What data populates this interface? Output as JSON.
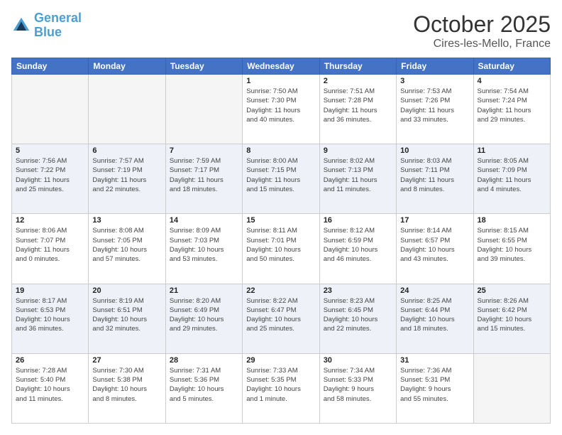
{
  "logo": {
    "line1": "General",
    "line2": "Blue"
  },
  "title": "October 2025",
  "location": "Cires-les-Mello, France",
  "weekdays": [
    "Sunday",
    "Monday",
    "Tuesday",
    "Wednesday",
    "Thursday",
    "Friday",
    "Saturday"
  ],
  "weeks": [
    [
      {
        "day": "",
        "info": ""
      },
      {
        "day": "",
        "info": ""
      },
      {
        "day": "",
        "info": ""
      },
      {
        "day": "1",
        "info": "Sunrise: 7:50 AM\nSunset: 7:30 PM\nDaylight: 11 hours\nand 40 minutes."
      },
      {
        "day": "2",
        "info": "Sunrise: 7:51 AM\nSunset: 7:28 PM\nDaylight: 11 hours\nand 36 minutes."
      },
      {
        "day": "3",
        "info": "Sunrise: 7:53 AM\nSunset: 7:26 PM\nDaylight: 11 hours\nand 33 minutes."
      },
      {
        "day": "4",
        "info": "Sunrise: 7:54 AM\nSunset: 7:24 PM\nDaylight: 11 hours\nand 29 minutes."
      }
    ],
    [
      {
        "day": "5",
        "info": "Sunrise: 7:56 AM\nSunset: 7:22 PM\nDaylight: 11 hours\nand 25 minutes."
      },
      {
        "day": "6",
        "info": "Sunrise: 7:57 AM\nSunset: 7:19 PM\nDaylight: 11 hours\nand 22 minutes."
      },
      {
        "day": "7",
        "info": "Sunrise: 7:59 AM\nSunset: 7:17 PM\nDaylight: 11 hours\nand 18 minutes."
      },
      {
        "day": "8",
        "info": "Sunrise: 8:00 AM\nSunset: 7:15 PM\nDaylight: 11 hours\nand 15 minutes."
      },
      {
        "day": "9",
        "info": "Sunrise: 8:02 AM\nSunset: 7:13 PM\nDaylight: 11 hours\nand 11 minutes."
      },
      {
        "day": "10",
        "info": "Sunrise: 8:03 AM\nSunset: 7:11 PM\nDaylight: 11 hours\nand 8 minutes."
      },
      {
        "day": "11",
        "info": "Sunrise: 8:05 AM\nSunset: 7:09 PM\nDaylight: 11 hours\nand 4 minutes."
      }
    ],
    [
      {
        "day": "12",
        "info": "Sunrise: 8:06 AM\nSunset: 7:07 PM\nDaylight: 11 hours\nand 0 minutes."
      },
      {
        "day": "13",
        "info": "Sunrise: 8:08 AM\nSunset: 7:05 PM\nDaylight: 10 hours\nand 57 minutes."
      },
      {
        "day": "14",
        "info": "Sunrise: 8:09 AM\nSunset: 7:03 PM\nDaylight: 10 hours\nand 53 minutes."
      },
      {
        "day": "15",
        "info": "Sunrise: 8:11 AM\nSunset: 7:01 PM\nDaylight: 10 hours\nand 50 minutes."
      },
      {
        "day": "16",
        "info": "Sunrise: 8:12 AM\nSunset: 6:59 PM\nDaylight: 10 hours\nand 46 minutes."
      },
      {
        "day": "17",
        "info": "Sunrise: 8:14 AM\nSunset: 6:57 PM\nDaylight: 10 hours\nand 43 minutes."
      },
      {
        "day": "18",
        "info": "Sunrise: 8:15 AM\nSunset: 6:55 PM\nDaylight: 10 hours\nand 39 minutes."
      }
    ],
    [
      {
        "day": "19",
        "info": "Sunrise: 8:17 AM\nSunset: 6:53 PM\nDaylight: 10 hours\nand 36 minutes."
      },
      {
        "day": "20",
        "info": "Sunrise: 8:19 AM\nSunset: 6:51 PM\nDaylight: 10 hours\nand 32 minutes."
      },
      {
        "day": "21",
        "info": "Sunrise: 8:20 AM\nSunset: 6:49 PM\nDaylight: 10 hours\nand 29 minutes."
      },
      {
        "day": "22",
        "info": "Sunrise: 8:22 AM\nSunset: 6:47 PM\nDaylight: 10 hours\nand 25 minutes."
      },
      {
        "day": "23",
        "info": "Sunrise: 8:23 AM\nSunset: 6:45 PM\nDaylight: 10 hours\nand 22 minutes."
      },
      {
        "day": "24",
        "info": "Sunrise: 8:25 AM\nSunset: 6:44 PM\nDaylight: 10 hours\nand 18 minutes."
      },
      {
        "day": "25",
        "info": "Sunrise: 8:26 AM\nSunset: 6:42 PM\nDaylight: 10 hours\nand 15 minutes."
      }
    ],
    [
      {
        "day": "26",
        "info": "Sunrise: 7:28 AM\nSunset: 5:40 PM\nDaylight: 10 hours\nand 11 minutes."
      },
      {
        "day": "27",
        "info": "Sunrise: 7:30 AM\nSunset: 5:38 PM\nDaylight: 10 hours\nand 8 minutes."
      },
      {
        "day": "28",
        "info": "Sunrise: 7:31 AM\nSunset: 5:36 PM\nDaylight: 10 hours\nand 5 minutes."
      },
      {
        "day": "29",
        "info": "Sunrise: 7:33 AM\nSunset: 5:35 PM\nDaylight: 10 hours\nand 1 minute."
      },
      {
        "day": "30",
        "info": "Sunrise: 7:34 AM\nSunset: 5:33 PM\nDaylight: 9 hours\nand 58 minutes."
      },
      {
        "day": "31",
        "info": "Sunrise: 7:36 AM\nSunset: 5:31 PM\nDaylight: 9 hours\nand 55 minutes."
      },
      {
        "day": "",
        "info": ""
      }
    ]
  ]
}
